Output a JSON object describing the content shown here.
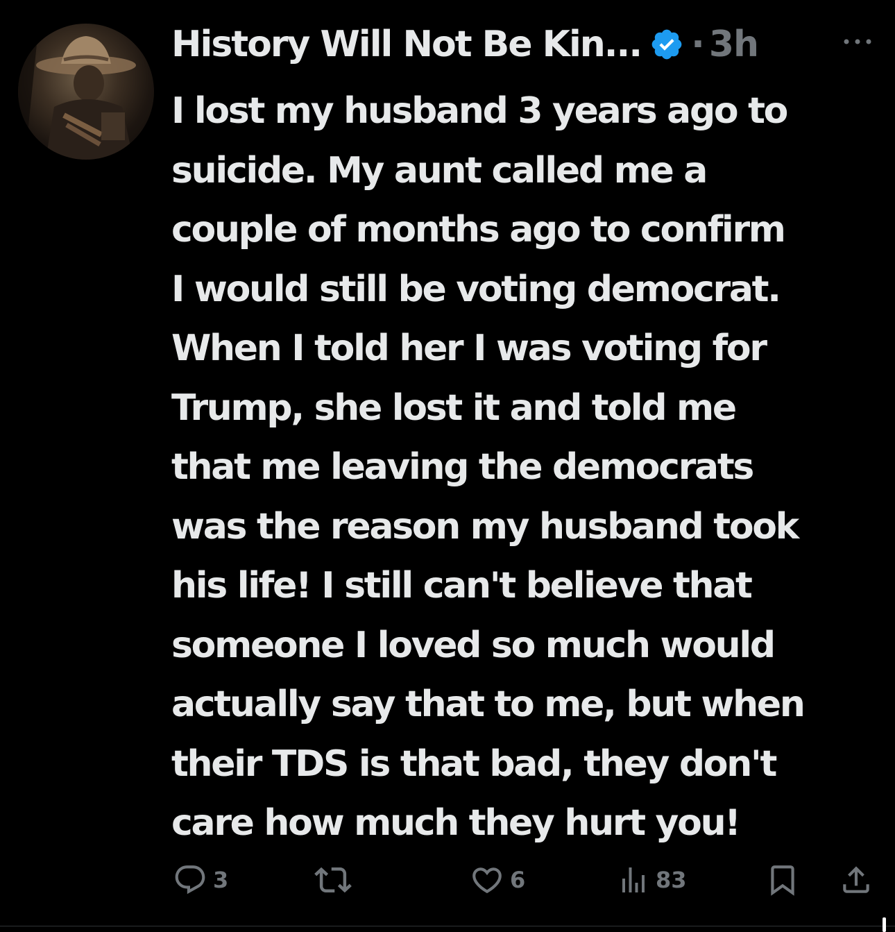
{
  "post": {
    "display_name": "History Will Not Be Kin...",
    "separator": "·",
    "time": "3h",
    "text_lines": [
      "I lost my husband 3 years ago to",
      "suicide. My aunt called me a",
      "couple of months ago to confirm",
      "I would still be voting democrat.",
      "When I told her I was voting for",
      "Trump, she lost it and told me",
      "that me leaving the democrats",
      "was the reason my husband took",
      "his life! I still can't believe that",
      "someone I loved so much would",
      "actually say that to me, but when",
      "their TDS is that bad, they don't",
      "care how much they hurt you!"
    ]
  },
  "actions": {
    "replies": "3",
    "reposts": "",
    "likes": "6",
    "views": "83"
  },
  "icons": {
    "verified": "verified-badge-icon",
    "more": "more-horizontal-icon",
    "reply": "reply-icon",
    "repost": "repost-icon",
    "like": "heart-icon",
    "views": "views-bar-icon",
    "bookmark": "bookmark-icon",
    "share": "share-icon"
  },
  "colors": {
    "background": "#000000",
    "text": "#e7e9ea",
    "secondary": "#71767b",
    "verified_blue": "#1d9bf0"
  }
}
